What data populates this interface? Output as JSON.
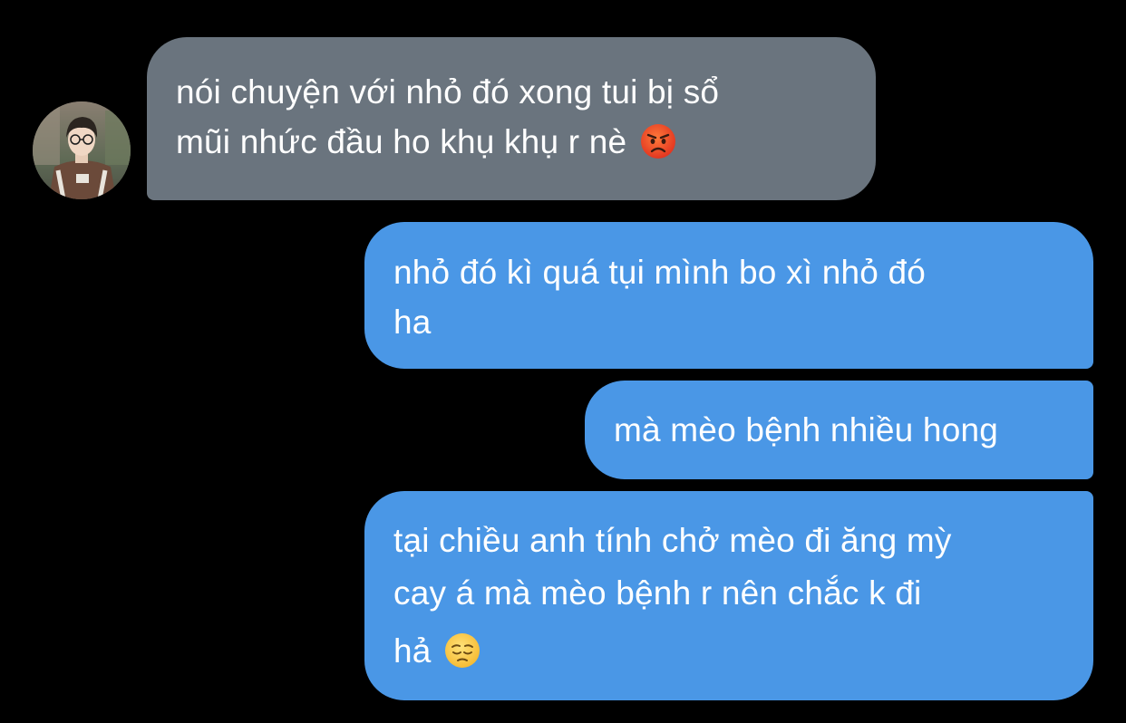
{
  "conversation": {
    "incoming": {
      "line1": "nói chuyện với nhỏ đó xong tui bị sổ",
      "line2": "mũi nhức đầu ho khụ khụ r nè",
      "emoji": "pouting-face-emoji"
    },
    "outgoing": [
      {
        "line1": "nhỏ đó kì quá tụi mình bo xì nhỏ đó",
        "line2": "ha"
      },
      {
        "line1": "mà mèo bệnh nhiều hong"
      },
      {
        "line1": "tại chiều anh tính chở mèo đi ăng mỳ",
        "line2": "cay á mà mèo bệnh r nên chắc k đi",
        "line3": "hả",
        "emoji": "pensive-face-emoji"
      }
    ]
  },
  "colors": {
    "background": "#000000",
    "incoming_bubble": "#6a747e",
    "outgoing_bubble": "#4a97e6",
    "text": "#ffffff"
  }
}
